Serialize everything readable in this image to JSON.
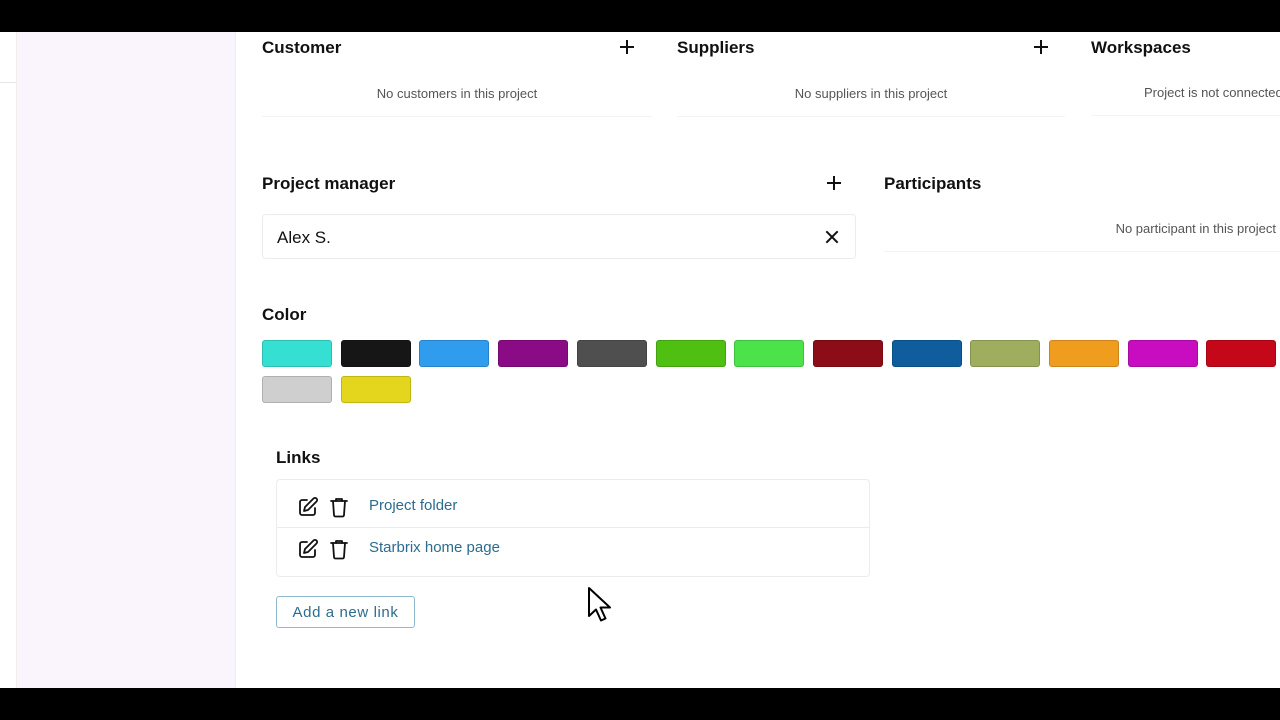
{
  "customer": {
    "title": "Customer",
    "empty_text": "No customers in this project"
  },
  "suppliers": {
    "title": "Suppliers",
    "empty_text": "No suppliers in this project"
  },
  "workspaces": {
    "title": "Workspaces",
    "empty_text": "Project is not connected"
  },
  "project_manager": {
    "title": "Project manager",
    "value": "Alex S."
  },
  "participants": {
    "title": "Participants",
    "empty_text": "No participant in this project"
  },
  "color": {
    "title": "Color",
    "swatches": [
      "#35e0d3",
      "#161616",
      "#2f9cee",
      "#8b0a85",
      "#4f4f4f",
      "#4fbf12",
      "#4ce24a",
      "#8c0d18",
      "#0f5d9c",
      "#9ead5e",
      "#ef9d1f",
      "#c80cbf",
      "#c5071a",
      "#cfcfcf",
      "#e3d61d"
    ]
  },
  "links": {
    "title": "Links",
    "items": [
      {
        "label": "Project folder"
      },
      {
        "label": "Starbrix home page"
      }
    ],
    "add_label": "Add a new link"
  },
  "icons": {
    "plus": "plus-icon",
    "clear": "close-icon",
    "edit": "edit-icon",
    "delete": "trash-icon",
    "pointer": "mouse-pointer-icon"
  }
}
